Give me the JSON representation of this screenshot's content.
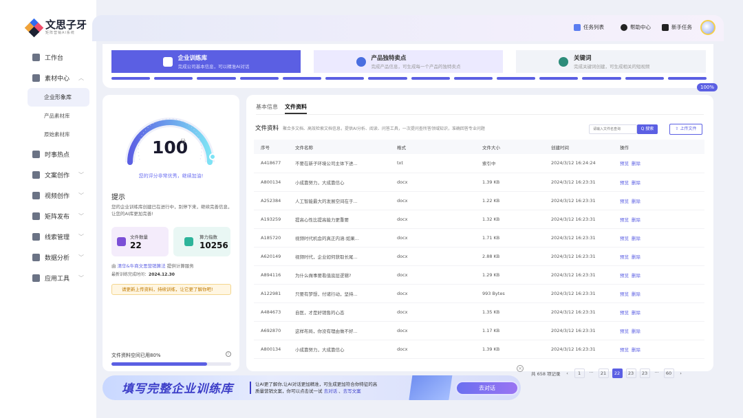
{
  "brand": {
    "name": "文思子牙",
    "sub": "矩阵营销AI系统"
  },
  "sidebar": {
    "items": [
      {
        "label": "工作台",
        "icon": "dashboard-icon",
        "chev": ""
      },
      {
        "label": "素材中心",
        "icon": "material-icon",
        "chev": "︿"
      },
      {
        "label": "时事热点",
        "icon": "news-icon",
        "chev": ""
      },
      {
        "label": "文案创作",
        "icon": "bulb-icon",
        "chev": "﹀"
      },
      {
        "label": "视频创作",
        "icon": "video-icon",
        "chev": "﹀"
      },
      {
        "label": "矩阵发布",
        "icon": "send-icon",
        "chev": "﹀"
      },
      {
        "label": "线索管理",
        "icon": "folder-icon",
        "chev": "﹀"
      },
      {
        "label": "数据分析",
        "icon": "chart-icon",
        "chev": "﹀"
      },
      {
        "label": "应用工具",
        "icon": "tool-icon",
        "chev": "﹀"
      }
    ],
    "subitems": [
      "企业形象库",
      "产品素材库",
      "原始素材库"
    ]
  },
  "topbar": {
    "tasks": "任务列表",
    "help": "帮助中心",
    "newbie": "新手任务"
  },
  "steps": [
    {
      "title": "企业训练库",
      "desc": "完成公司基本信息，可以精准AI对话"
    },
    {
      "title": "产品独特卖点",
      "desc": "完成产品信息，可生成每一个产品的独特卖点"
    },
    {
      "title": "关键词",
      "desc": "完成关键词创建，可生成相关的短视频"
    }
  ],
  "progress": {
    "label": "100%",
    "value": 1.0
  },
  "score": {
    "value": "100",
    "unit": "分",
    "praise": "您的评分非常优秀，继续加油!",
    "max": 100
  },
  "tip": {
    "title": "提示",
    "text": "您的企业训练库创建已在进行中，别停下来，继续完善信息，让您的AI库更加完善!"
  },
  "stats": {
    "files_label": "文件数量",
    "files_value": "22",
    "power_label": "算力指数",
    "power_value": "10256"
  },
  "provider": {
    "prefix": "由",
    "name": "清华&牛商文思营销算法",
    "suffix": "提供计算服务"
  },
  "last_train": {
    "label": "最新训练完成时间：",
    "value": "2024.12.30"
  },
  "notice": "请更新上传资料，持续训练，让它更了解你吧!",
  "storage": {
    "label": "文件资料空间已用80%",
    "used": 0.8,
    "info": "i"
  },
  "tabs": [
    "基本信息",
    "文件资料"
  ],
  "files": {
    "title": "文件资料",
    "desc": "聚合多文档、高效检索文档信息，提供AI分析、阅读、问答工具，一次提问查所答领域知识，准确回答专业问题",
    "search_placeholder": "请输入文件名查询",
    "search_btn": "Q 搜索",
    "upload_btn": "⇧ 上传文件",
    "headers": [
      "序号",
      "文件名称",
      "格式",
      "文件大小",
      "创建时间",
      "操作"
    ],
    "rows": [
      [
        "A418677",
        "不要在新子环境公司主体下进...",
        "txt",
        "索引中",
        "2024/3/12 16:24:24"
      ],
      [
        "A800134",
        "小成靠努力，大成靠信心",
        "docx",
        "1.39 KB",
        "2024/3/12 16:23:31"
      ],
      [
        "A252384",
        "人工智能最大的发展空间在于...",
        "docx",
        "1.22 KB",
        "2024/3/12 16:23:31"
      ],
      [
        "A193259",
        "提高心性比提高能力更重要",
        "docx",
        "1.32 KB",
        "2024/3/12 16:23:31"
      ],
      [
        "A185720",
        "视频时代机会的真正内涵:如果...",
        "docx",
        "1.71 KB",
        "2024/3/12 16:23:31"
      ],
      [
        "A620149",
        "视频时代，企业如何获取长尾...",
        "docx",
        "2.88 KB",
        "2024/3/12 16:23:31"
      ],
      [
        "A894116",
        "为什么做事要看值底层逻辑?",
        "docx",
        "1.29 KB",
        "2024/3/12 16:23:31"
      ],
      [
        "A122981",
        "只要有梦想，付诸行动，坚持...",
        "docx",
        "993 Bytes",
        "2024/3/12 16:23:31"
      ],
      [
        "A484673",
        "自医，才是好销售的心态",
        "docx",
        "1.35 KB",
        "2024/3/12 16:23:31"
      ],
      [
        "A692870",
        "这样布局，你没有理由做不好...",
        "docx",
        "1.17 KB",
        "2024/3/12 16:23:31"
      ],
      [
        "A800134",
        "小成靠努力，大成靠信心",
        "docx",
        "1.39 KB",
        "2024/3/12 16:23:31"
      ]
    ],
    "ops": [
      "预览",
      "删除"
    ]
  },
  "pager": {
    "total": "共 658 项记录",
    "pages": [
      "1",
      "...",
      "21",
      "22",
      "23",
      "23",
      "...",
      "60"
    ],
    "current": "22"
  },
  "banner": {
    "title": "填写完整企业训练库",
    "line1": "让AI更了解你,让AI对话更加精准，可生成更加符合你特征的高",
    "line2a": "质量营销文案，你可以点击试一试 ",
    "link1": "去对话",
    "sep": " 、",
    "link2": "去写文案",
    "button": "去对话"
  },
  "colors": {
    "accent": "#5b5fe3",
    "warn": "#c07a00"
  }
}
